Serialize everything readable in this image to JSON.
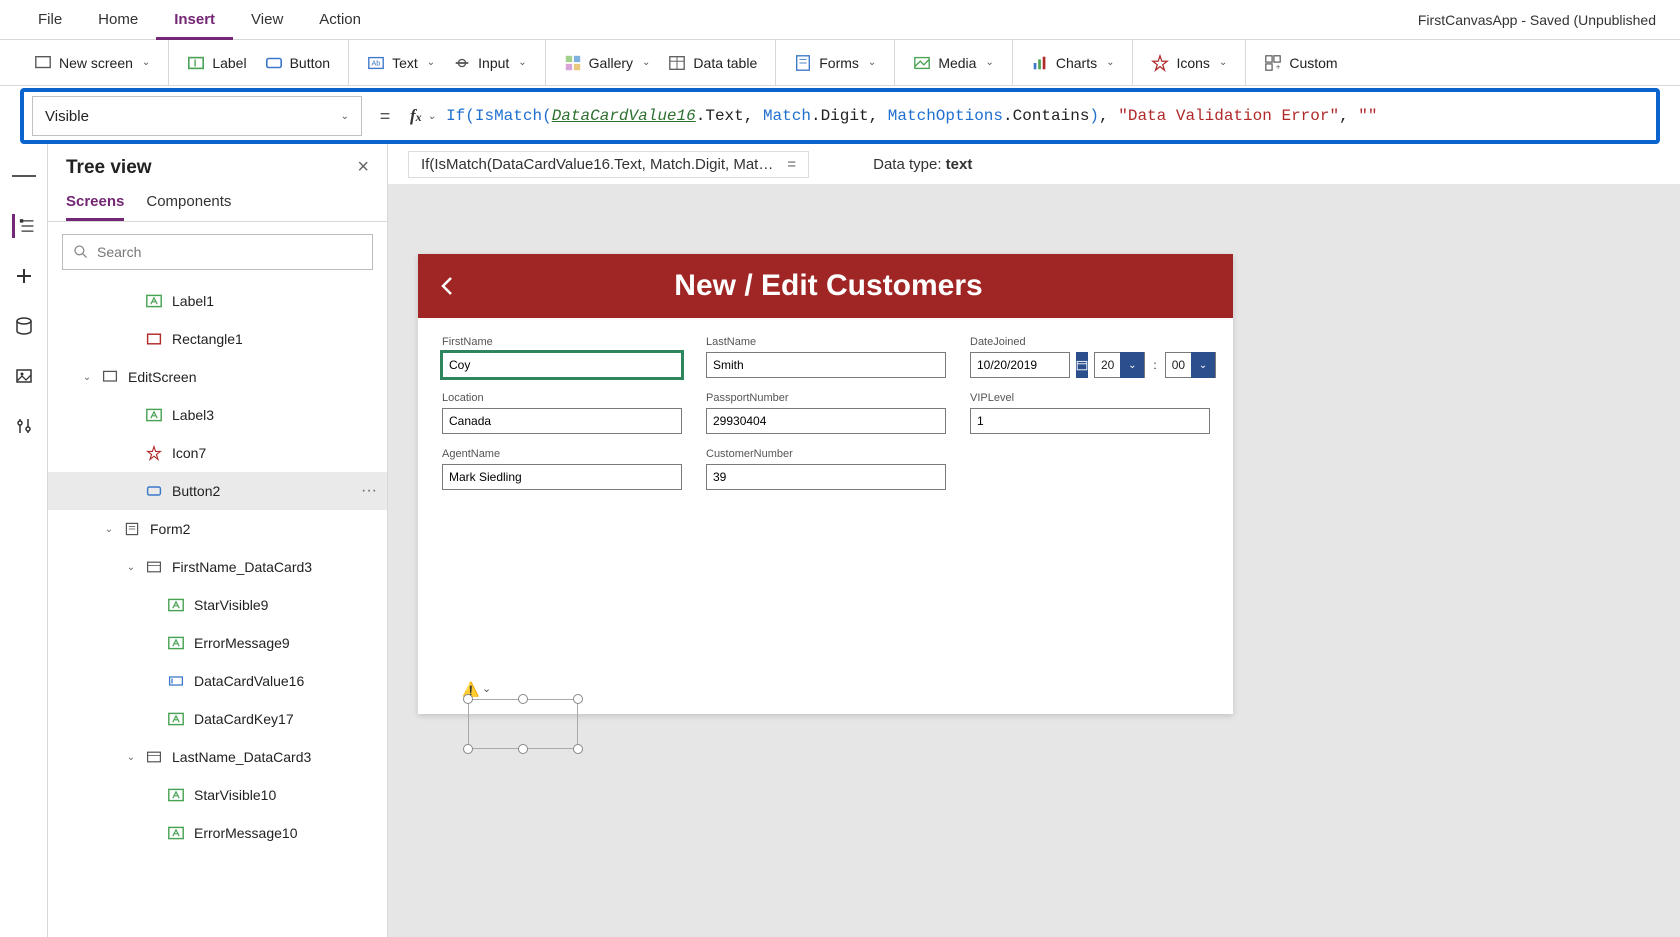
{
  "app_title": "FirstCanvasApp - Saved (Unpublished",
  "menubar": [
    "File",
    "Home",
    "Insert",
    "View",
    "Action"
  ],
  "menubar_active": "Insert",
  "ribbon": {
    "new_screen": "New screen",
    "label": "Label",
    "button": "Button",
    "text": "Text",
    "input": "Input",
    "gallery": "Gallery",
    "data_table": "Data table",
    "forms": "Forms",
    "media": "Media",
    "charts": "Charts",
    "icons": "Icons",
    "custom": "Custom"
  },
  "property": {
    "name": "Visible"
  },
  "formula": {
    "tokens": [
      {
        "t": "fn",
        "v": "If"
      },
      {
        "t": "paren",
        "v": "("
      },
      {
        "t": "fn",
        "v": "IsMatch"
      },
      {
        "t": "paren",
        "v": "("
      },
      {
        "t": "ref",
        "v": "DataCardValue16"
      },
      {
        "t": "plain",
        "v": ".Text, "
      },
      {
        "t": "kw",
        "v": "Match"
      },
      {
        "t": "plain",
        "v": ".Digit, "
      },
      {
        "t": "kw",
        "v": "MatchOptions"
      },
      {
        "t": "plain",
        "v": ".Contains"
      },
      {
        "t": "paren",
        "v": ")"
      },
      {
        "t": "plain",
        "v": ", "
      },
      {
        "t": "str",
        "v": "\"Data Validation Error\""
      },
      {
        "t": "plain",
        "v": ", "
      },
      {
        "t": "str",
        "v": "\"\""
      }
    ],
    "echo_text": "If(IsMatch(DataCardValue16.Text, Match.Digit, Mat…",
    "echo_eq": "=",
    "data_type_label": "Data type:",
    "data_type_value": "text"
  },
  "tree": {
    "title": "Tree view",
    "tabs": [
      "Screens",
      "Components"
    ],
    "tabs_active": "Screens",
    "search_placeholder": "Search",
    "nodes": [
      {
        "depth": 3,
        "icon": "label",
        "label": "Label1",
        "caret": ""
      },
      {
        "depth": 3,
        "icon": "rect",
        "label": "Rectangle1",
        "caret": ""
      },
      {
        "depth": 1,
        "icon": "screen",
        "label": "EditScreen",
        "caret": "v"
      },
      {
        "depth": 3,
        "icon": "label",
        "label": "Label3",
        "caret": ""
      },
      {
        "depth": 3,
        "icon": "icon",
        "label": "Icon7",
        "caret": ""
      },
      {
        "depth": 3,
        "icon": "button",
        "label": "Button2",
        "caret": "",
        "selected": true,
        "more": true
      },
      {
        "depth": 2,
        "icon": "form",
        "label": "Form2",
        "caret": "v"
      },
      {
        "depth": 3,
        "icon": "card",
        "label": "FirstName_DataCard3",
        "caret": "v"
      },
      {
        "depth": 4,
        "icon": "label",
        "label": "StarVisible9",
        "caret": ""
      },
      {
        "depth": 4,
        "icon": "label",
        "label": "ErrorMessage9",
        "caret": ""
      },
      {
        "depth": 4,
        "icon": "textinput",
        "label": "DataCardValue16",
        "caret": ""
      },
      {
        "depth": 4,
        "icon": "label",
        "label": "DataCardKey17",
        "caret": ""
      },
      {
        "depth": 3,
        "icon": "card",
        "label": "LastName_DataCard3",
        "caret": "v"
      },
      {
        "depth": 4,
        "icon": "label",
        "label": "StarVisible10",
        "caret": ""
      },
      {
        "depth": 4,
        "icon": "label",
        "label": "ErrorMessage10",
        "caret": ""
      }
    ]
  },
  "canvas": {
    "header_title": "New / Edit Customers",
    "fields": {
      "first_name": {
        "label": "FirstName",
        "value": "Coy",
        "selected": true
      },
      "last_name": {
        "label": "LastName",
        "value": "Smith"
      },
      "date_joined": {
        "label": "DateJoined",
        "value": "10/20/2019",
        "hour": "20",
        "minute": "00"
      },
      "location": {
        "label": "Location",
        "value": "Canada"
      },
      "passport": {
        "label": "PassportNumber",
        "value": "29930404"
      },
      "vip": {
        "label": "VIPLevel",
        "value": "1"
      },
      "agent": {
        "label": "AgentName",
        "value": "Mark Siedling"
      },
      "customer_no": {
        "label": "CustomerNumber",
        "value": "39"
      }
    }
  },
  "icons_semantic": {
    "close": "×",
    "chevron": "⌄"
  }
}
